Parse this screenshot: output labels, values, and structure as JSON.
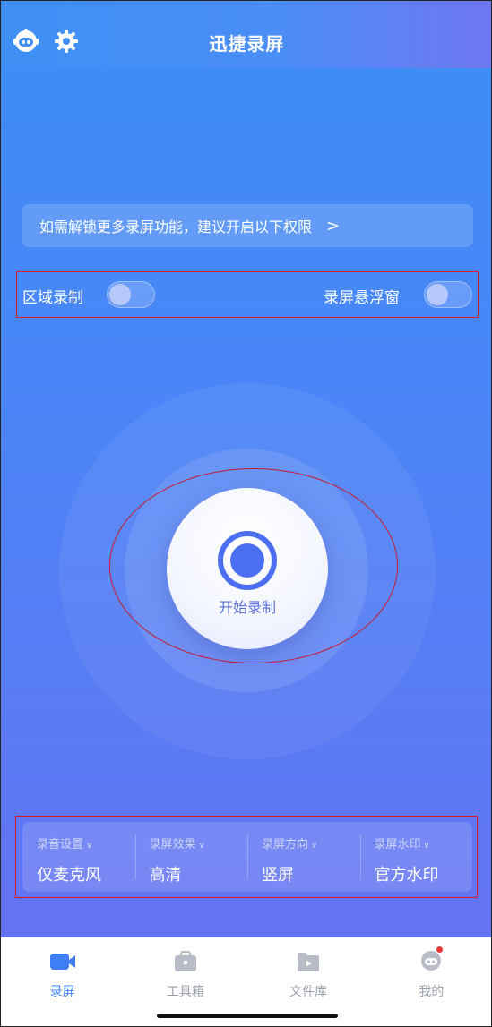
{
  "header": {
    "title": "迅捷录屏"
  },
  "banner": {
    "text": "如需解锁更多录屏功能，建议开启以下权限",
    "chevron": ">"
  },
  "toggles": {
    "region_record": {
      "label": "区域录制",
      "on": false
    },
    "floating_window": {
      "label": "录屏悬浮窗",
      "on": false
    }
  },
  "record_button": {
    "label": "开始录制"
  },
  "settings": [
    {
      "label": "录音设置",
      "value": "仅麦克风"
    },
    {
      "label": "录屏效果",
      "value": "高清"
    },
    {
      "label": "录屏方向",
      "value": "竖屏"
    },
    {
      "label": "录屏水印",
      "value": "官方水印"
    }
  ],
  "nav": [
    {
      "label": "录屏",
      "icon": "video-camera-icon",
      "active": true
    },
    {
      "label": "工具箱",
      "icon": "toolbox-icon",
      "active": false
    },
    {
      "label": "文件库",
      "icon": "file-library-icon",
      "active": false
    },
    {
      "label": "我的",
      "icon": "profile-icon",
      "active": false,
      "badge": true
    }
  ],
  "colors": {
    "accent": "#3f7ef5",
    "annotation": "#d21c2a",
    "badge": "#e53935"
  }
}
